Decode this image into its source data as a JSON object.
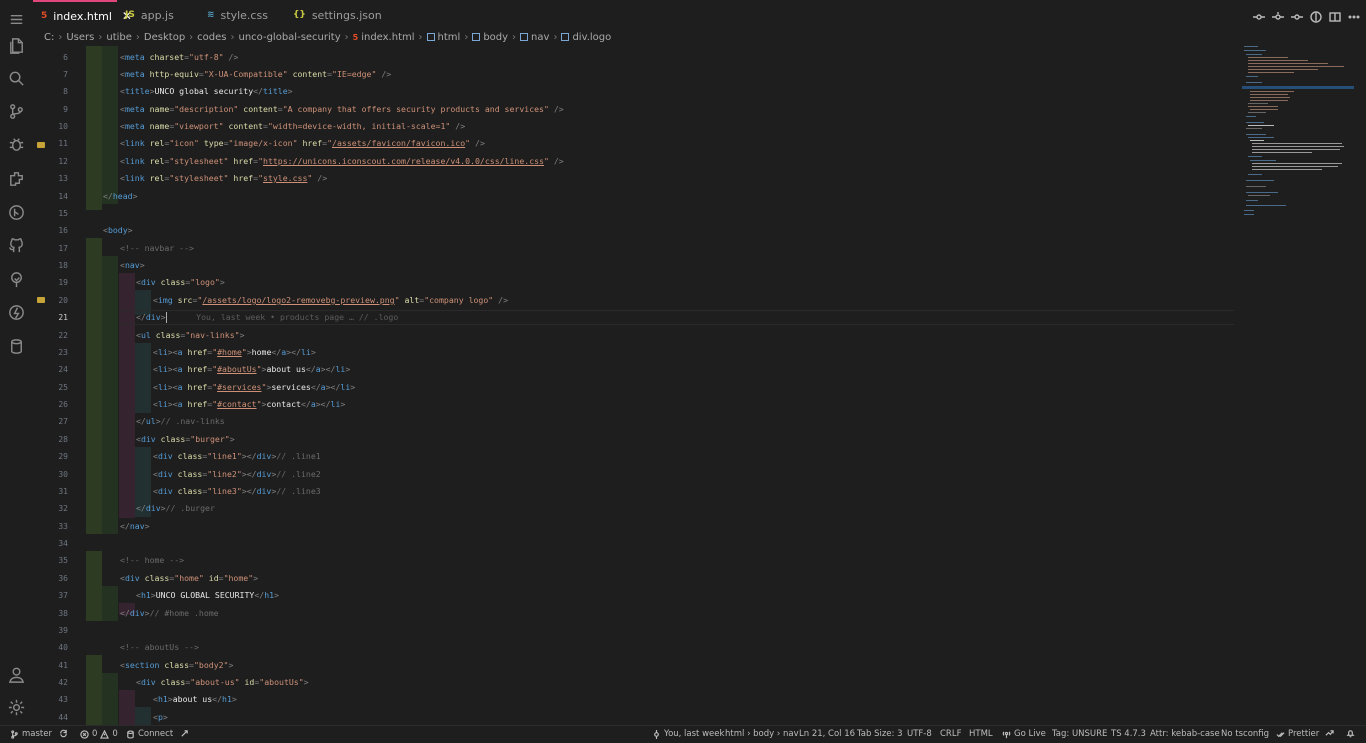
{
  "tabs": [
    {
      "label": "index.html",
      "icon": "html-file-icon",
      "active": true
    },
    {
      "label": "app.js",
      "icon": "js-file-icon",
      "active": false
    },
    {
      "label": "style.css",
      "icon": "css-file-icon",
      "active": false
    },
    {
      "label": "settings.json",
      "icon": "json-file-icon",
      "active": false
    }
  ],
  "breadcrumb": [
    "C:",
    "Users",
    "utibe",
    "Desktop",
    "codes",
    "unco-global-security",
    "index.html",
    "html",
    "body",
    "nav",
    "div.logo"
  ],
  "lines": {
    "n6": "6",
    "n7": "7",
    "n8": "8",
    "n9": "9",
    "n10": "10",
    "n11": "11",
    "n12": "12",
    "n13": "13",
    "n14": "14",
    "n15": "15",
    "n16": "16",
    "n17": "17",
    "n18": "18",
    "n19": "19",
    "n20": "20",
    "n21": "21",
    "n22": "22",
    "n23": "23",
    "n24": "24",
    "n25": "25",
    "n26": "26",
    "n27": "27",
    "n28": "28",
    "n29": "29",
    "n30": "30",
    "n31": "31",
    "n32": "32",
    "n33": "33",
    "n34": "34",
    "n35": "35",
    "n36": "36",
    "n37": "37",
    "n38": "38",
    "n39": "39",
    "n40": "40",
    "n41": "41",
    "n42": "42",
    "n43": "43",
    "n44": "44"
  },
  "code": {
    "l6_charset": "\"utf-8\"",
    "l7_equiv": "\"X-UA-Compatible\"",
    "l7_content": "\"IE=edge\"",
    "l8_title": "UNCO global security",
    "l9_name": "\"description\"",
    "l9_content": "\"A company that offers security products and services\"",
    "l10_name": "\"viewport\"",
    "l10_content": "\"width=device-width, initial-scale=1\"",
    "l11_rel": "\"icon\"",
    "l11_type": "\"image/x-icon\"",
    "l11_href": "/assets/favicon/favicon.ico",
    "l12_rel": "\"stylesheet\"",
    "l12_href": "https://unicons.iconscout.com/release/v4.0.0/css/line.css",
    "l13_rel": "\"stylesheet\"",
    "l13_href": "style.css",
    "l17_comment": "<!-- navbar -->",
    "l19_class": "\"logo\"",
    "l20_src": "/assets/logo/logo2-removebg-preview.png",
    "l20_alt": "\"company logo\"",
    "l21_blame": "You, last week • products page …",
    "l21_after": "// .logo",
    "l22_class": "\"nav-links\"",
    "l23_href": "#home",
    "l23_text": "home",
    "l24_href": "#aboutUs",
    "l24_text": "about us",
    "l25_href": "#services",
    "l25_text": "services",
    "l26_href": "#contact",
    "l26_text": "contact",
    "l27_comment": "// .nav-links",
    "l28_class": "\"burger\"",
    "l29_class": "\"line1\"",
    "l29_comment": "// .line1",
    "l30_class": "\"line2\"",
    "l30_comment": "// .line2",
    "l31_class": "\"line3\"",
    "l31_comment": "// .line3",
    "l32_comment": "// .burger",
    "l35_comment": "<!-- home -->",
    "l36_class": "\"home\"",
    "l36_id": "\"home\"",
    "l37_text": "UNCO GLOBAL SECURITY",
    "l38_comment": "// #home .home",
    "l40_comment": "<!-- aboutUs -->",
    "l41_class": "\"body2\"",
    "l42_class": "\"about-us\"",
    "l42_id": "\"aboutUs\"",
    "l43_text": "about us"
  },
  "status": {
    "branch": "master",
    "problems_errors": "0",
    "problems_warnings": "0",
    "connect": "Connect",
    "blame": "You, last week",
    "path": "html › body › nav",
    "position": "Ln 21, Col 16",
    "tab_size": "Tab Size: 3",
    "encoding": "UTF-8",
    "eol": "CRLF",
    "language": "HTML",
    "go_live": "Go Live",
    "tag": "Tag: UNSURE",
    "ts": "TS 4.7.3",
    "attr": "Attr: kebab-case",
    "tsconfig": "No tsconfig",
    "prettier": "Prettier"
  },
  "colors": {
    "tag": "#569cd6",
    "attr": "#dcdcaa",
    "string": "#ce9178",
    "comment": "#6a6a6a",
    "html_icon": "#e34c26",
    "js_icon": "#cbcb41",
    "css_icon": "#519aba",
    "json_icon": "#cbcb41"
  }
}
